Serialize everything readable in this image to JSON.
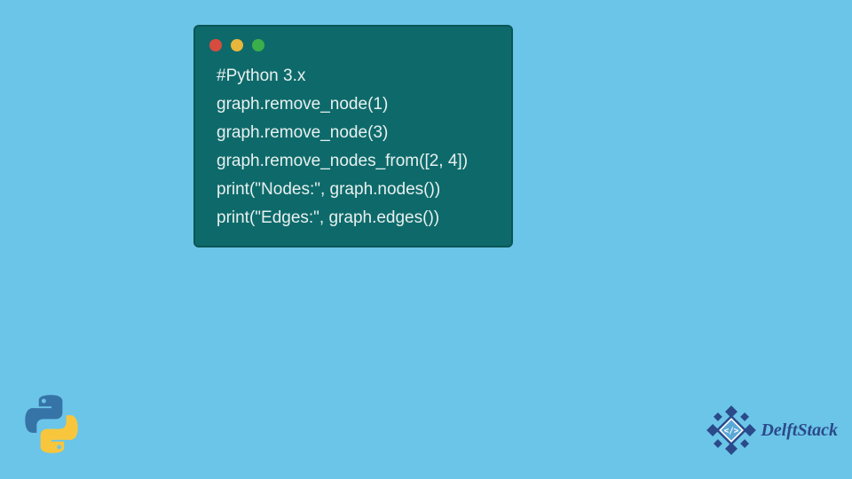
{
  "window": {
    "traffic_lights": [
      "red",
      "yellow",
      "green"
    ]
  },
  "code": {
    "lines": [
      "#Python 3.x",
      "graph.remove_node(1)",
      "graph.remove_node(3)",
      "graph.remove_nodes_from([2, 4])",
      "print(\"Nodes:\", graph.nodes())",
      "print(\"Edges:\", graph.edges())"
    ]
  },
  "branding": {
    "site_name": "DelftStack",
    "colors": {
      "background": "#6bc5e8",
      "code_bg": "#0e6a6a",
      "code_text": "#e8f0f0",
      "brand_blue": "#2a4a8a"
    }
  }
}
